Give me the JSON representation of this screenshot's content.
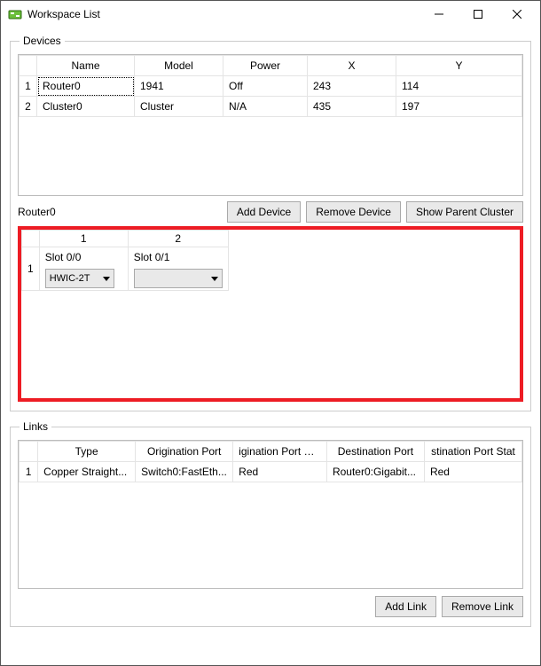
{
  "window": {
    "title": "Workspace List"
  },
  "devices": {
    "legend": "Devices",
    "headers": {
      "name": "Name",
      "model": "Model",
      "power": "Power",
      "x": "X",
      "y": "Y"
    },
    "rows": [
      {
        "idx": "1",
        "name": "Router0",
        "model": "1941",
        "power": "Off",
        "x": "243",
        "y": "114"
      },
      {
        "idx": "2",
        "name": "Cluster0",
        "model": "Cluster",
        "power": "N/A",
        "x": "435",
        "y": "197"
      }
    ],
    "selected_name": "Router0",
    "buttons": {
      "add": "Add Device",
      "remove": "Remove Device",
      "show_parent": "Show Parent Cluster"
    }
  },
  "slots": {
    "row_label": "1",
    "cols": [
      {
        "col": "1",
        "label": "Slot 0/0",
        "value": "HWIC-2T"
      },
      {
        "col": "2",
        "label": "Slot 0/1",
        "value": ""
      }
    ]
  },
  "links": {
    "legend": "Links",
    "headers": {
      "type": "Type",
      "orig_port": "Origination Port",
      "orig_status": "igination Port Stat",
      "dest_port": "Destination Port",
      "dest_status": "stination Port Stat"
    },
    "rows": [
      {
        "idx": "1",
        "type": "Copper Straight...",
        "orig_port": "Switch0:FastEth...",
        "orig_status": "Red",
        "dest_port": "Router0:Gigabit...",
        "dest_status": "Red"
      }
    ],
    "buttons": {
      "add": "Add Link",
      "remove": "Remove Link"
    }
  }
}
